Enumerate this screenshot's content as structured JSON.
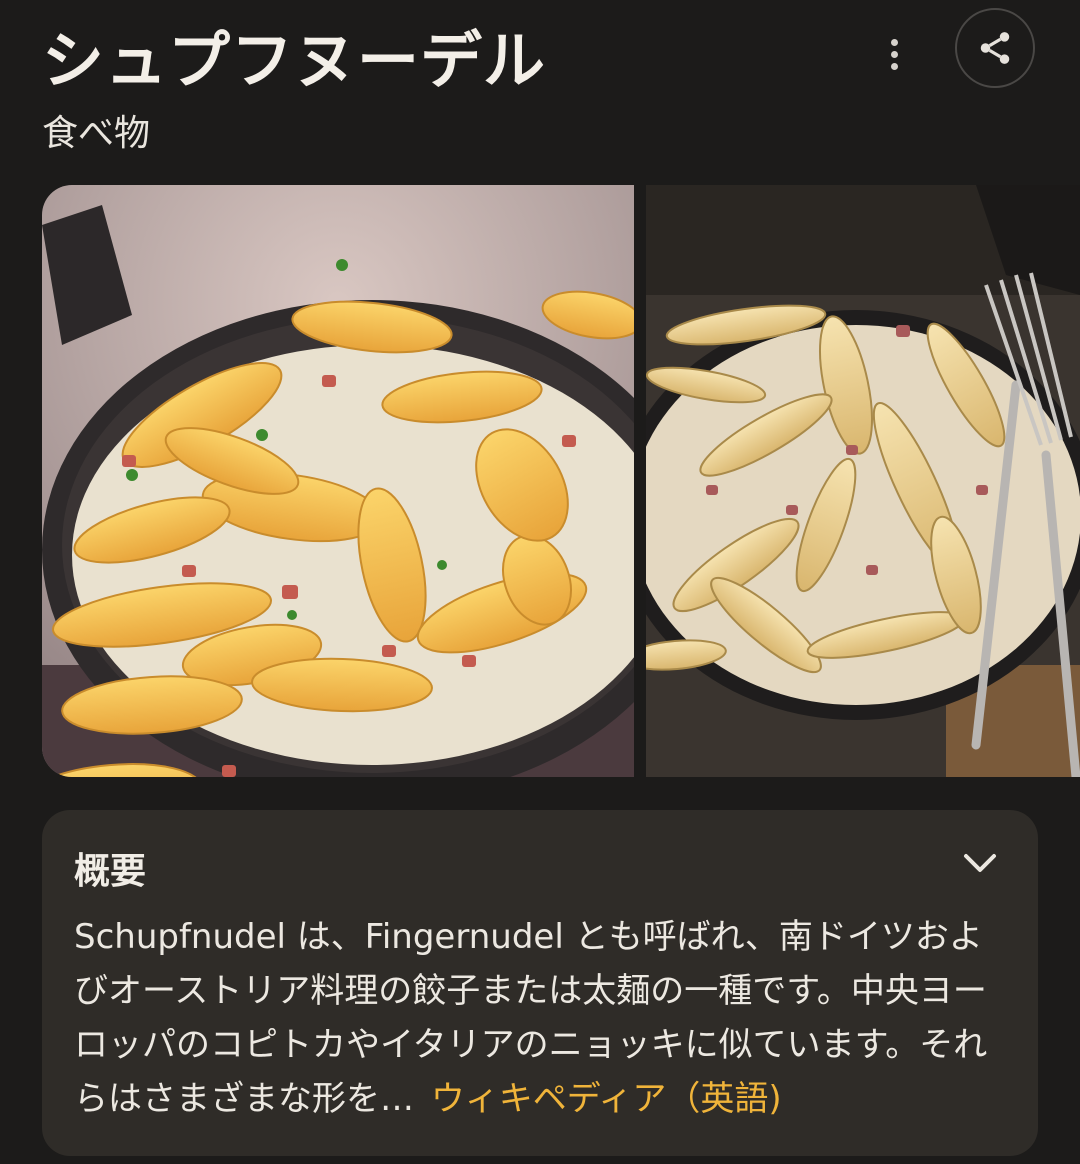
{
  "header": {
    "title": "シュプフヌーデル",
    "subtitle": "食べ物",
    "more_icon": "more-vert-icon",
    "share_icon": "share-icon"
  },
  "images": [
    {
      "name": "schupfnudel-image-1",
      "kind": "photo"
    },
    {
      "name": "schupfnudel-image-2",
      "kind": "photo"
    }
  ],
  "overview": {
    "label": "概要",
    "expand_icon": "chevron-down-icon",
    "snippet": "Schupfnudel は、Fingernudel とも呼ばれ、南ドイツおよびオーストリア料理の餃子または太麺の一種です。中央ヨーロッパのコピトカやイタリアのニョッキに似ています。それらはさまざまな形を…",
    "source_link": "ウィキペディア（英語)",
    "link_color": "#f0b43a"
  },
  "colors": {
    "background": "#1c1b1a",
    "card": "#2f2c28",
    "accent": "#f0b43a"
  }
}
